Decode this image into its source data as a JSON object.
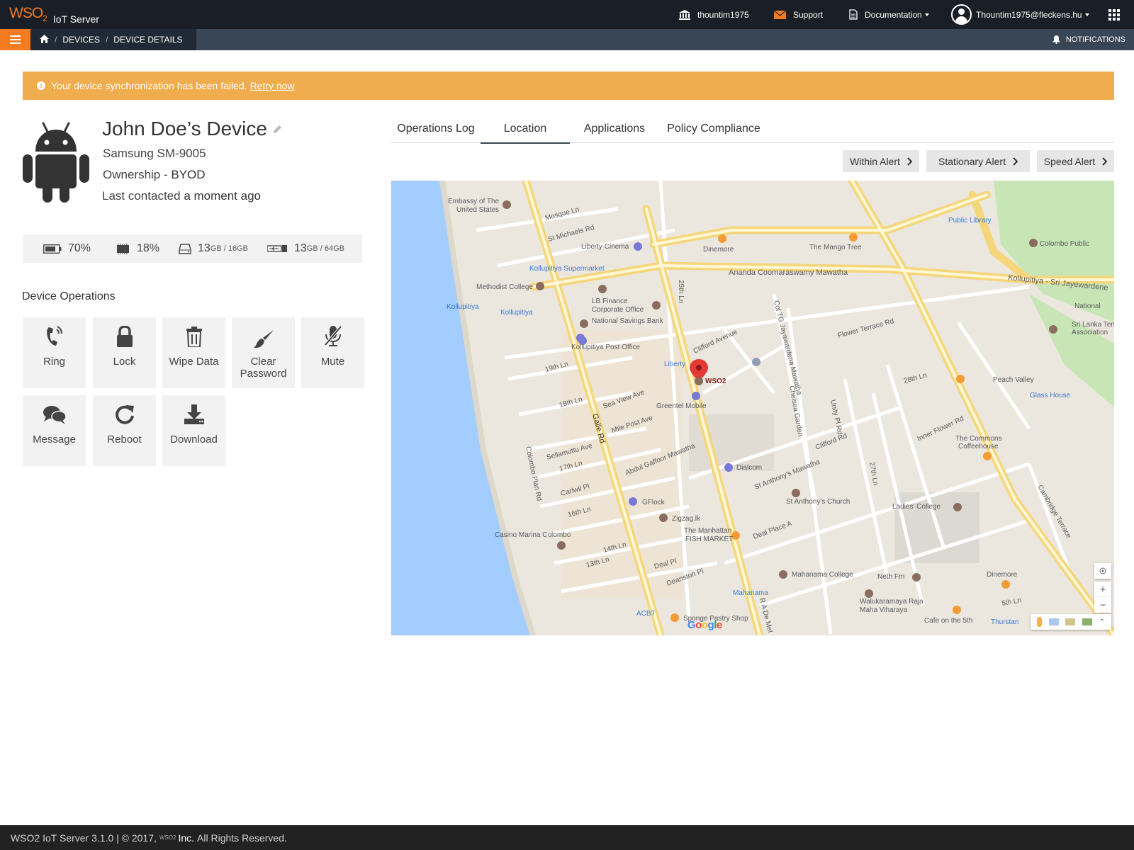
{
  "header": {
    "brand_logo": "WSO",
    "brand_logo_sub": "2",
    "brand_name": "IoT Server",
    "tenant": "thountim1975",
    "support": "Support",
    "documentation": "Documentation",
    "user": "Thountim1975@fleckens.hu"
  },
  "breadcrumb": {
    "devices": "DEVICES",
    "device_details": "DEVICE DETAILS",
    "separator": "/",
    "notifications": "NOTIFICATIONS"
  },
  "alert": {
    "message": "Your device synchronization has been failed.",
    "action": "Retry now"
  },
  "device": {
    "name": "John Doe’s Device",
    "model": "Samsung SM-9005",
    "ownership_label": "Ownership - ",
    "ownership_value": "BYOD",
    "contact_label": "Last contacted ",
    "contact_value": "a moment ago"
  },
  "stats": {
    "battery": "70%",
    "cpu": "18%",
    "storage_used": "13",
    "storage_total": "GB / 16GB",
    "external_used": "13",
    "external_total": "GB / 64GB"
  },
  "operations": {
    "title": "Device Operations",
    "items": [
      {
        "label": "Ring",
        "icon": "ring-icon"
      },
      {
        "label": "Lock",
        "icon": "lock-icon"
      },
      {
        "label": "Wipe Data",
        "icon": "trash-icon"
      },
      {
        "label": "Clear Password",
        "icon": "brush-icon"
      },
      {
        "label": "Mute",
        "icon": "mic-off-icon"
      },
      {
        "label": "Message",
        "icon": "chat-icon"
      },
      {
        "label": "Reboot",
        "icon": "refresh-icon"
      },
      {
        "label": "Download",
        "icon": "download-icon"
      }
    ]
  },
  "tabs": {
    "items": [
      "Operations Log",
      "Location",
      "Applications",
      "Policy Compliance"
    ],
    "active": "Location"
  },
  "geo_alerts": {
    "within": "Within Alert",
    "stationary": "Stationary Alert",
    "speed": "Speed Alert"
  },
  "map": {
    "marker_label": "WSO2",
    "labels": [
      "Embassy of The",
      "United States",
      "Mosque Ln",
      "St Michaels Rd",
      "Liberty Cinema",
      "Dinemore",
      "The Mango Tree",
      "Public Library",
      "Colombo Public",
      "Kollupitiya Supermarket",
      "Ananda Coomaraswamy Mawatha",
      "Kollupitiya - Sri Jayewardene",
      "Methodist College",
      "LB Finance",
      "Corporate Office",
      "National Savings Bank",
      "Kollupitiya",
      "Kollupitiya Post Office",
      "Liberty",
      "Clifford Avenue",
      "Flower Terrace Rd",
      "National",
      "Sri Lanka Tennis",
      "Association",
      "19th Ln",
      "Greentel Mobile",
      "28th Ln",
      "Peach Valley",
      "Glass House",
      "Galle Rd",
      "18th Ln",
      "Sea View Ave",
      "Mile Post Ave",
      "Sellamuttu Ave",
      "Chelsea Garden",
      "Inner Flower Rd",
      "The Commons",
      "Coffeehouse",
      "Abdul Gaffoor Mawatha",
      "17th Ln",
      "Dialcom",
      "Carlwil Pl",
      "St Anthony's Mawatha",
      "GFlock",
      "St Anthony's Church",
      "Ladies' College",
      "16th Ln",
      "Zigzag.lk",
      "Casino Marina Colombo",
      "The Manhattan",
      "FISH MARKET",
      "Deal Place A",
      "14th Ln",
      "13th Ln",
      "Deal Pl",
      "Mahanama College",
      "Neth Fm",
      "Dinemore",
      "Deanston Pl",
      "Mahanama",
      "Walukaramaya Raja",
      "Maha Viharaya",
      "ACBT",
      "Sponge Pastry Shop",
      "Cafe on the 5th",
      "Thurstan",
      "Colombo Plan Rd",
      "Cambridge Terrace",
      "25th Ln",
      "27th Ln",
      "Unity Pl Rd",
      "Col TG Jayawardena Mawatha",
      "R A De Mel",
      "5th Ln",
      "Clifford Rd"
    ],
    "google": "Google"
  },
  "footer": {
    "text": "WSO2 IoT Server 3.1.0 | © 2017,",
    "logo": "WSO2",
    "inc": "Inc.",
    "rights": "All Rights Reserved."
  }
}
